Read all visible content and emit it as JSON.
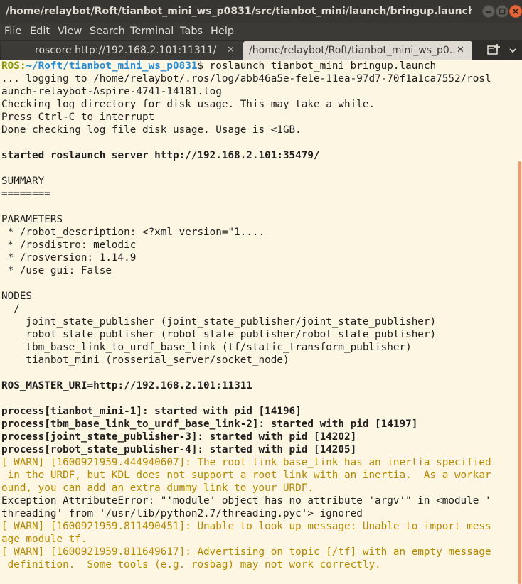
{
  "window": {
    "title": "/home/relaybot/Roft/tianbot_mini_ws_p0831/src/tianbot_mini/launch/bringup.launch http:...",
    "colors": {
      "titlebar": "#373633",
      "menubar": "#3b3a37",
      "close_button": "#e3663a",
      "background": "#fdf6e3",
      "scrollbar": "#ee9a6a"
    }
  },
  "menu": [
    "File",
    "Edit",
    "View",
    "Search",
    "Terminal",
    "Tabs",
    "Help"
  ],
  "tabs": [
    {
      "label": "roscore http://192.168.2.101:11311/",
      "close": "✕",
      "active": false
    },
    {
      "label": "/home/relaybot/Roft/tianbot_mini_ws_p0...",
      "close": "✕",
      "active": true
    }
  ],
  "icons": {
    "minimize": "minimize-icon",
    "maximize": "maximize-icon",
    "close": "close-icon",
    "new_tab": "new-tab-icon",
    "tab_menu": "tab-menu-icon"
  },
  "terminal": {
    "prompt": {
      "user": "ROS:",
      "path": "~/Roft/tianbot_mini_ws_p0831",
      "symbol": "$",
      "command": " roslaunch tianbot_mini bringup.launch"
    },
    "lines": [
      {
        "text": "... logging to /home/relaybot/.ros/log/abb46a5e-fe1e-11ea-97d7-70f1a1ca7552/rosl",
        "style": "normal"
      },
      {
        "text": "aunch-relaybot-Aspire-4741-14181.log",
        "style": "normal"
      },
      {
        "text": "Checking log directory for disk usage. This may take a while.",
        "style": "normal"
      },
      {
        "text": "Press Ctrl-C to interrupt",
        "style": "normal"
      },
      {
        "text": "Done checking log file disk usage. Usage is <1GB.",
        "style": "normal"
      },
      {
        "text": "",
        "style": "normal"
      },
      {
        "text": "started roslaunch server http://192.168.2.101:35479/",
        "style": "bold"
      },
      {
        "text": "",
        "style": "normal"
      },
      {
        "text": "SUMMARY",
        "style": "normal"
      },
      {
        "text": "========",
        "style": "normal"
      },
      {
        "text": "",
        "style": "normal"
      },
      {
        "text": "PARAMETERS",
        "style": "normal"
      },
      {
        "text": " * /robot_description: <?xml version=\"1....",
        "style": "normal"
      },
      {
        "text": " * /rosdistro: melodic",
        "style": "normal"
      },
      {
        "text": " * /rosversion: 1.14.9",
        "style": "normal"
      },
      {
        "text": " * /use_gui: False",
        "style": "normal"
      },
      {
        "text": "",
        "style": "normal"
      },
      {
        "text": "NODES",
        "style": "normal"
      },
      {
        "text": "  /",
        "style": "normal"
      },
      {
        "text": "    joint_state_publisher (joint_state_publisher/joint_state_publisher)",
        "style": "normal"
      },
      {
        "text": "    robot_state_publisher (robot_state_publisher/robot_state_publisher)",
        "style": "normal"
      },
      {
        "text": "    tbm_base_link_to_urdf_base_link (tf/static_transform_publisher)",
        "style": "normal"
      },
      {
        "text": "    tianbot_mini (rosserial_server/socket_node)",
        "style": "normal"
      },
      {
        "text": "",
        "style": "normal"
      },
      {
        "text": "ROS_MASTER_URI=http://192.168.2.101:11311",
        "style": "bold"
      },
      {
        "text": "",
        "style": "normal"
      },
      {
        "text": "process[tianbot_mini-1]: started with pid [14196]",
        "style": "bold"
      },
      {
        "text": "process[tbm_base_link_to_urdf_base_link-2]: started with pid [14197]",
        "style": "bold"
      },
      {
        "text": "process[joint_state_publisher-3]: started with pid [14202]",
        "style": "bold"
      },
      {
        "text": "process[robot_state_publisher-4]: started with pid [14205]",
        "style": "bold"
      },
      {
        "text": "[ WARN] [1600921959.444940607]: The root link base_link has an inertia specified",
        "style": "warn"
      },
      {
        "text": " in the URDF, but KDL does not support a root link with an inertia.  As a workar",
        "style": "warn"
      },
      {
        "text": "ound, you can add an extra dummy link to your URDF.",
        "style": "warn"
      },
      {
        "text": "Exception AttributeError: \"'module' object has no attribute 'argv'\" in <module '",
        "style": "normal"
      },
      {
        "text": "threading' from '/usr/lib/python2.7/threading.pyc'> ignored",
        "style": "normal"
      },
      {
        "text": "[ WARN] [1600921959.811490451]: Unable to look up message: Unable to import mess",
        "style": "warn"
      },
      {
        "text": "age module tf.",
        "style": "warn"
      },
      {
        "text": "[ WARN] [1600921959.811649617]: Advertising on topic [/tf] with an empty message",
        "style": "warn"
      },
      {
        "text": " definition.  Some tools (e.g. rosbag) may not work correctly.",
        "style": "warn"
      }
    ]
  }
}
